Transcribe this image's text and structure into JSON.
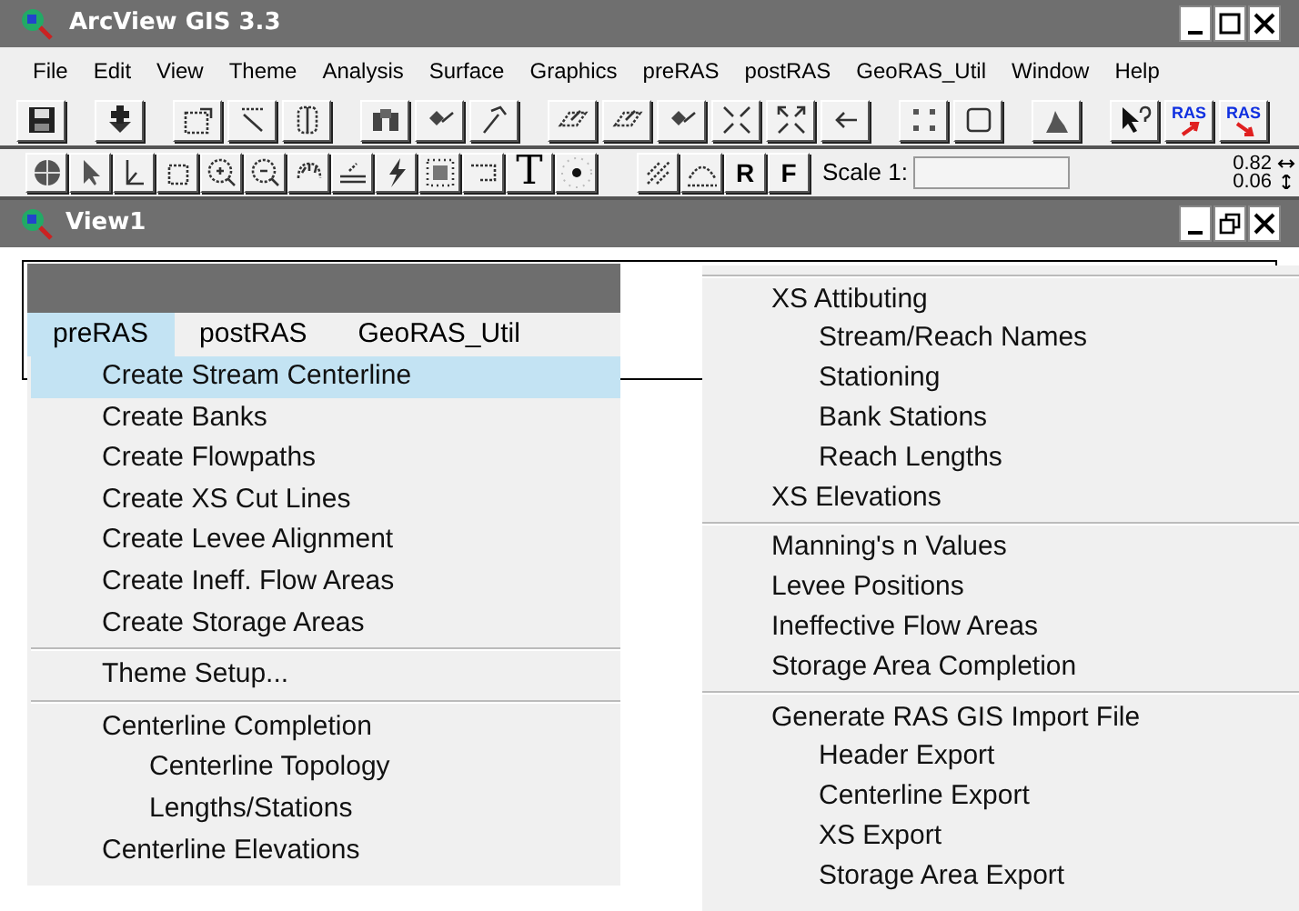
{
  "window": {
    "title": "ArcView GIS 3.3"
  },
  "menu_bar": [
    "File",
    "Edit",
    "View",
    "Theme",
    "Analysis",
    "Surface",
    "Graphics",
    "preRAS",
    "postRAS",
    "GeoRAS_Util",
    "Window",
    "Help"
  ],
  "tool_bar_1": {
    "ras_buttons": [
      "RAS",
      "RAS"
    ]
  },
  "tool_bar_2": {
    "text_tool": "T",
    "r_button": "R",
    "f_button": "F",
    "scale_label": "Scale 1:",
    "readings": [
      "0.82",
      "0.06"
    ]
  },
  "view_window": {
    "title": "View1"
  },
  "left_menu": {
    "menu_bar": [
      {
        "label": "preRAS",
        "selected": true
      },
      {
        "label": "postRAS",
        "selected": false
      },
      {
        "label": "GeoRAS_Util",
        "selected": false
      }
    ],
    "groups": [
      [
        {
          "label": "Create Stream Centerline",
          "selected": true
        },
        {
          "label": "Create Banks",
          "selected": false
        },
        {
          "label": "Create Flowpaths",
          "selected": false
        },
        {
          "label": "Create XS Cut Lines",
          "selected": false
        },
        {
          "label": "Create Levee Alignment",
          "selected": false
        },
        {
          "label": "Create Ineff. Flow Areas",
          "selected": false
        },
        {
          "label": "Create Storage Areas",
          "selected": false
        }
      ],
      [
        {
          "label": "Theme Setup...",
          "selected": false
        }
      ],
      [
        {
          "label": "Centerline Completion",
          "selected": false,
          "children": [
            {
              "label": "Centerline Topology",
              "selected": false
            },
            {
              "label": "Lengths/Stations",
              "selected": false
            }
          ]
        },
        {
          "label": "Centerline Elevations",
          "selected": false
        }
      ]
    ]
  },
  "right_menu": {
    "groups": [
      [
        {
          "label": "XS Attibuting",
          "selected": false,
          "children": [
            {
              "label": "Stream/Reach Names",
              "selected": false
            },
            {
              "label": "Stationing",
              "selected": false
            },
            {
              "label": "Bank Stations",
              "selected": false
            },
            {
              "label": "Reach Lengths",
              "selected": false
            }
          ]
        },
        {
          "label": "XS Elevations",
          "selected": false
        }
      ],
      [
        {
          "label": "Manning's n Values",
          "selected": false
        },
        {
          "label": "Levee Positions",
          "selected": false
        },
        {
          "label": "Ineffective Flow Areas",
          "selected": false
        },
        {
          "label": "Storage Area Completion",
          "selected": false
        }
      ],
      [
        {
          "label": "Generate RAS GIS Import File",
          "selected": false,
          "children": [
            {
              "label": "Header Export",
              "selected": false
            },
            {
              "label": "Centerline Export",
              "selected": false
            },
            {
              "label": "XS Export",
              "selected": false
            },
            {
              "label": "Storage Area Export",
              "selected": false
            }
          ]
        }
      ]
    ]
  }
}
